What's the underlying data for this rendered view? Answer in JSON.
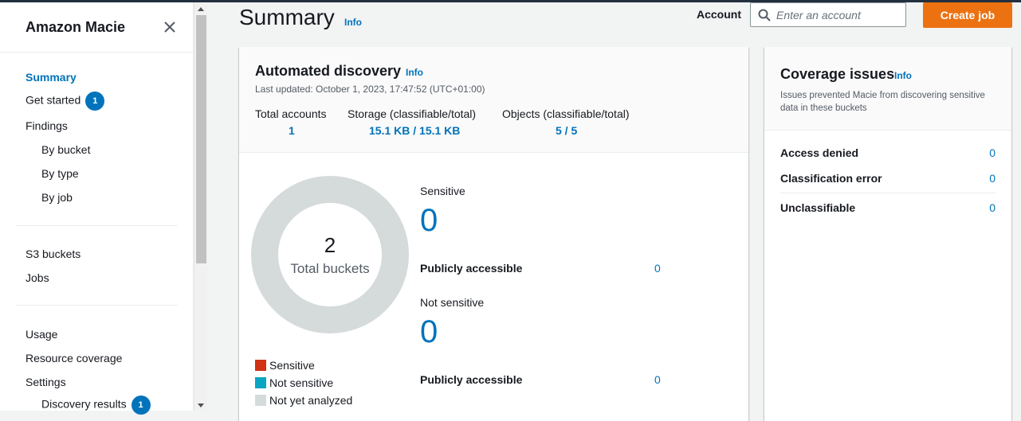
{
  "sidebar": {
    "title": "Amazon Macie",
    "items": [
      {
        "label": "Summary"
      },
      {
        "label": "Get started",
        "badge": "1"
      },
      {
        "label": "Findings"
      },
      {
        "label": "By bucket"
      },
      {
        "label": "By type"
      },
      {
        "label": "By job"
      },
      {
        "label": "S3 buckets"
      },
      {
        "label": "Jobs"
      },
      {
        "label": "Usage"
      },
      {
        "label": "Resource coverage"
      },
      {
        "label": "Settings"
      },
      {
        "label": "Discovery results",
        "badge": "1"
      }
    ]
  },
  "header": {
    "title": "Summary",
    "info": "Info",
    "account_label": "Account",
    "account_placeholder": "Enter an account",
    "create_job": "Create job"
  },
  "discovery": {
    "title": "Automated discovery",
    "info": "Info",
    "last_updated": "Last updated: October 1, 2023, 17:47:52 (UTC+01:00)",
    "stats": [
      {
        "label": "Total accounts",
        "value": "1"
      },
      {
        "label": "Storage (classifiable/total)",
        "value": "15.1 KB / 15.1 KB"
      },
      {
        "label": "Objects (classifiable/total)",
        "value": "5 / 5"
      }
    ],
    "donut": {
      "count": "2",
      "label": "Total buckets"
    },
    "legend": [
      {
        "label": "Sensitive",
        "color": "#d13212"
      },
      {
        "label": "Not sensitive",
        "color": "#0aa5c2"
      },
      {
        "label": "Not yet analyzed",
        "color": "#d5dbdb"
      }
    ],
    "sensitive": {
      "label": "Sensitive",
      "value": "0",
      "public_label": "Publicly accessible",
      "public_value": "0"
    },
    "not_sensitive": {
      "label": "Not sensitive",
      "value": "0",
      "public_label": "Publicly accessible",
      "public_value": "0"
    }
  },
  "coverage": {
    "title": "Coverage issues",
    "info": "Info",
    "description": "Issues prevented Macie from discovering sensitive data in these buckets",
    "rows": [
      {
        "label": "Access denied",
        "value": "0"
      },
      {
        "label": "Classification error",
        "value": "0"
      },
      {
        "label": "Unclassifiable",
        "value": "0"
      }
    ]
  },
  "colors": {
    "accent": "#0073bb",
    "primary_button": "#ec7211",
    "donut_gray": "#d5dbdb"
  },
  "icons": {
    "close": "close-icon",
    "search": "search-icon"
  }
}
